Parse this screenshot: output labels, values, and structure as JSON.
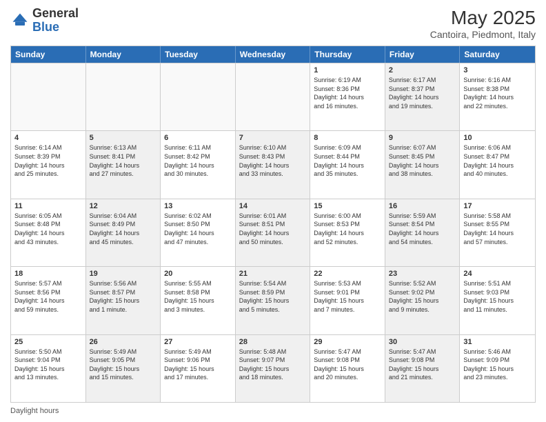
{
  "header": {
    "logo_general": "General",
    "logo_blue": "Blue",
    "month_title": "May 2025",
    "subtitle": "Cantoira, Piedmont, Italy"
  },
  "footer": {
    "daylight_label": "Daylight hours"
  },
  "weekdays": [
    "Sunday",
    "Monday",
    "Tuesday",
    "Wednesday",
    "Thursday",
    "Friday",
    "Saturday"
  ],
  "weeks": [
    {
      "cells": [
        {
          "day": "",
          "info": "",
          "shaded": false,
          "empty": true
        },
        {
          "day": "",
          "info": "",
          "shaded": false,
          "empty": true
        },
        {
          "day": "",
          "info": "",
          "shaded": false,
          "empty": true
        },
        {
          "day": "",
          "info": "",
          "shaded": false,
          "empty": true
        },
        {
          "day": "1",
          "info": "Sunrise: 6:19 AM\nSunset: 8:36 PM\nDaylight: 14 hours\nand 16 minutes.",
          "shaded": false,
          "empty": false
        },
        {
          "day": "2",
          "info": "Sunrise: 6:17 AM\nSunset: 8:37 PM\nDaylight: 14 hours\nand 19 minutes.",
          "shaded": true,
          "empty": false
        },
        {
          "day": "3",
          "info": "Sunrise: 6:16 AM\nSunset: 8:38 PM\nDaylight: 14 hours\nand 22 minutes.",
          "shaded": false,
          "empty": false
        }
      ]
    },
    {
      "cells": [
        {
          "day": "4",
          "info": "Sunrise: 6:14 AM\nSunset: 8:39 PM\nDaylight: 14 hours\nand 25 minutes.",
          "shaded": false,
          "empty": false
        },
        {
          "day": "5",
          "info": "Sunrise: 6:13 AM\nSunset: 8:41 PM\nDaylight: 14 hours\nand 27 minutes.",
          "shaded": true,
          "empty": false
        },
        {
          "day": "6",
          "info": "Sunrise: 6:11 AM\nSunset: 8:42 PM\nDaylight: 14 hours\nand 30 minutes.",
          "shaded": false,
          "empty": false
        },
        {
          "day": "7",
          "info": "Sunrise: 6:10 AM\nSunset: 8:43 PM\nDaylight: 14 hours\nand 33 minutes.",
          "shaded": true,
          "empty": false
        },
        {
          "day": "8",
          "info": "Sunrise: 6:09 AM\nSunset: 8:44 PM\nDaylight: 14 hours\nand 35 minutes.",
          "shaded": false,
          "empty": false
        },
        {
          "day": "9",
          "info": "Sunrise: 6:07 AM\nSunset: 8:45 PM\nDaylight: 14 hours\nand 38 minutes.",
          "shaded": true,
          "empty": false
        },
        {
          "day": "10",
          "info": "Sunrise: 6:06 AM\nSunset: 8:47 PM\nDaylight: 14 hours\nand 40 minutes.",
          "shaded": false,
          "empty": false
        }
      ]
    },
    {
      "cells": [
        {
          "day": "11",
          "info": "Sunrise: 6:05 AM\nSunset: 8:48 PM\nDaylight: 14 hours\nand 43 minutes.",
          "shaded": false,
          "empty": false
        },
        {
          "day": "12",
          "info": "Sunrise: 6:04 AM\nSunset: 8:49 PM\nDaylight: 14 hours\nand 45 minutes.",
          "shaded": true,
          "empty": false
        },
        {
          "day": "13",
          "info": "Sunrise: 6:02 AM\nSunset: 8:50 PM\nDaylight: 14 hours\nand 47 minutes.",
          "shaded": false,
          "empty": false
        },
        {
          "day": "14",
          "info": "Sunrise: 6:01 AM\nSunset: 8:51 PM\nDaylight: 14 hours\nand 50 minutes.",
          "shaded": true,
          "empty": false
        },
        {
          "day": "15",
          "info": "Sunrise: 6:00 AM\nSunset: 8:53 PM\nDaylight: 14 hours\nand 52 minutes.",
          "shaded": false,
          "empty": false
        },
        {
          "day": "16",
          "info": "Sunrise: 5:59 AM\nSunset: 8:54 PM\nDaylight: 14 hours\nand 54 minutes.",
          "shaded": true,
          "empty": false
        },
        {
          "day": "17",
          "info": "Sunrise: 5:58 AM\nSunset: 8:55 PM\nDaylight: 14 hours\nand 57 minutes.",
          "shaded": false,
          "empty": false
        }
      ]
    },
    {
      "cells": [
        {
          "day": "18",
          "info": "Sunrise: 5:57 AM\nSunset: 8:56 PM\nDaylight: 14 hours\nand 59 minutes.",
          "shaded": false,
          "empty": false
        },
        {
          "day": "19",
          "info": "Sunrise: 5:56 AM\nSunset: 8:57 PM\nDaylight: 15 hours\nand 1 minute.",
          "shaded": true,
          "empty": false
        },
        {
          "day": "20",
          "info": "Sunrise: 5:55 AM\nSunset: 8:58 PM\nDaylight: 15 hours\nand 3 minutes.",
          "shaded": false,
          "empty": false
        },
        {
          "day": "21",
          "info": "Sunrise: 5:54 AM\nSunset: 8:59 PM\nDaylight: 15 hours\nand 5 minutes.",
          "shaded": true,
          "empty": false
        },
        {
          "day": "22",
          "info": "Sunrise: 5:53 AM\nSunset: 9:01 PM\nDaylight: 15 hours\nand 7 minutes.",
          "shaded": false,
          "empty": false
        },
        {
          "day": "23",
          "info": "Sunrise: 5:52 AM\nSunset: 9:02 PM\nDaylight: 15 hours\nand 9 minutes.",
          "shaded": true,
          "empty": false
        },
        {
          "day": "24",
          "info": "Sunrise: 5:51 AM\nSunset: 9:03 PM\nDaylight: 15 hours\nand 11 minutes.",
          "shaded": false,
          "empty": false
        }
      ]
    },
    {
      "cells": [
        {
          "day": "25",
          "info": "Sunrise: 5:50 AM\nSunset: 9:04 PM\nDaylight: 15 hours\nand 13 minutes.",
          "shaded": false,
          "empty": false
        },
        {
          "day": "26",
          "info": "Sunrise: 5:49 AM\nSunset: 9:05 PM\nDaylight: 15 hours\nand 15 minutes.",
          "shaded": true,
          "empty": false
        },
        {
          "day": "27",
          "info": "Sunrise: 5:49 AM\nSunset: 9:06 PM\nDaylight: 15 hours\nand 17 minutes.",
          "shaded": false,
          "empty": false
        },
        {
          "day": "28",
          "info": "Sunrise: 5:48 AM\nSunset: 9:07 PM\nDaylight: 15 hours\nand 18 minutes.",
          "shaded": true,
          "empty": false
        },
        {
          "day": "29",
          "info": "Sunrise: 5:47 AM\nSunset: 9:08 PM\nDaylight: 15 hours\nand 20 minutes.",
          "shaded": false,
          "empty": false
        },
        {
          "day": "30",
          "info": "Sunrise: 5:47 AM\nSunset: 9:08 PM\nDaylight: 15 hours\nand 21 minutes.",
          "shaded": true,
          "empty": false
        },
        {
          "day": "31",
          "info": "Sunrise: 5:46 AM\nSunset: 9:09 PM\nDaylight: 15 hours\nand 23 minutes.",
          "shaded": false,
          "empty": false
        }
      ]
    }
  ]
}
